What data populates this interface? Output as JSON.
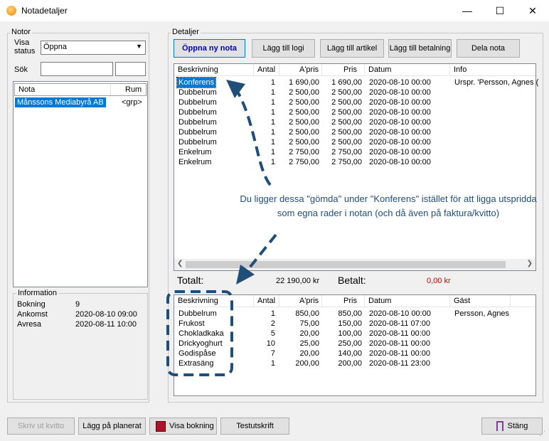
{
  "window": {
    "title": "Notadetaljer",
    "minimize": "—",
    "maximize": "☐",
    "close": "✕"
  },
  "notor": {
    "group_label": "Notor",
    "visa_status_label": "Visa status",
    "status_value": "Öppna",
    "sok_label": "Sök",
    "columns": [
      "Nota",
      "Rum"
    ],
    "rows": [
      {
        "nota": "Månssons Mediabyrå AB",
        "rum": "<grp>"
      }
    ]
  },
  "information": {
    "group_label": "Information",
    "rows": [
      {
        "label": "Bokning",
        "value": "9"
      },
      {
        "label": "Ankomst",
        "value": "2020-08-10 09:00"
      },
      {
        "label": "Avresa",
        "value": "2020-08-11 10:00"
      }
    ]
  },
  "detaljer": {
    "group_label": "Detaljer",
    "buttons": [
      "Öppna ny nota",
      "Lägg till logi",
      "Lägg till artikel",
      "Lägg till betalning",
      "Dela nota"
    ],
    "upper_columns": [
      "Beskrivning",
      "Antal",
      "A'pris",
      "Pris",
      "Datum",
      "Info"
    ],
    "upper_rows": [
      {
        "beskrivning": "Konferens",
        "antal": "1",
        "apris": "1 690,00",
        "pris": "1 690,00",
        "datum": "2020-08-10 00:00",
        "info": "Urspr. 'Persson, Agnes ("
      },
      {
        "beskrivning": "Dubbelrum",
        "antal": "1",
        "apris": "2 500,00",
        "pris": "2 500,00",
        "datum": "2020-08-10 00:00",
        "info": ""
      },
      {
        "beskrivning": "Dubbelrum",
        "antal": "1",
        "apris": "2 500,00",
        "pris": "2 500,00",
        "datum": "2020-08-10 00:00",
        "info": ""
      },
      {
        "beskrivning": "Dubbelrum",
        "antal": "1",
        "apris": "2 500,00",
        "pris": "2 500,00",
        "datum": "2020-08-10 00:00",
        "info": ""
      },
      {
        "beskrivning": "Dubbelrum",
        "antal": "1",
        "apris": "2 500,00",
        "pris": "2 500,00",
        "datum": "2020-08-10 00:00",
        "info": ""
      },
      {
        "beskrivning": "Dubbelrum",
        "antal": "1",
        "apris": "2 500,00",
        "pris": "2 500,00",
        "datum": "2020-08-10 00:00",
        "info": ""
      },
      {
        "beskrivning": "Dubbelrum",
        "antal": "1",
        "apris": "2 500,00",
        "pris": "2 500,00",
        "datum": "2020-08-10 00:00",
        "info": ""
      },
      {
        "beskrivning": "Enkelrum",
        "antal": "1",
        "apris": "2 750,00",
        "pris": "2 750,00",
        "datum": "2020-08-10 00:00",
        "info": ""
      },
      {
        "beskrivning": "Enkelrum",
        "antal": "1",
        "apris": "2 750,00",
        "pris": "2 750,00",
        "datum": "2020-08-10 00:00",
        "info": ""
      }
    ],
    "annotation": "Du ligger dessa \"gömda\" under \"Konferens\" istället för att ligga utspridda som egna rader i notan (och då även på faktura/kvitto)",
    "totalt_label": "Totalt:",
    "totalt_value": "22 190,00 kr",
    "betalt_label": "Betalt:",
    "betalt_value": "0,00 kr",
    "lower_columns": [
      "Beskrivning",
      "Antal",
      "A'pris",
      "Pris",
      "Datum",
      "Gäst"
    ],
    "lower_rows": [
      {
        "beskrivning": "Dubbelrum",
        "antal": "1",
        "apris": "850,00",
        "pris": "850,00",
        "datum": "2020-08-10 00:00",
        "gast": "Persson, Agnes"
      },
      {
        "beskrivning": "Frukost",
        "antal": "2",
        "apris": "75,00",
        "pris": "150,00",
        "datum": "2020-08-11 07:00",
        "gast": ""
      },
      {
        "beskrivning": "Chokladkaka",
        "antal": "5",
        "apris": "20,00",
        "pris": "100,00",
        "datum": "2020-08-11 00:00",
        "gast": ""
      },
      {
        "beskrivning": "Drickyoghurt",
        "antal": "10",
        "apris": "25,00",
        "pris": "250,00",
        "datum": "2020-08-11 00:00",
        "gast": ""
      },
      {
        "beskrivning": "Godispåse",
        "antal": "7",
        "apris": "20,00",
        "pris": "140,00",
        "datum": "2020-08-11 00:00",
        "gast": ""
      },
      {
        "beskrivning": "Extrasäng",
        "antal": "1",
        "apris": "200,00",
        "pris": "200,00",
        "datum": "2020-08-11 23:00",
        "gast": ""
      }
    ]
  },
  "footer": {
    "buttons": [
      "Skriv ut kvitto",
      "Lägg på planerat",
      "Visa bokning",
      "Testutskrift"
    ],
    "close_button": "Stäng"
  },
  "colors": {
    "selection": "#0078d7",
    "annotation": "#1f4e79",
    "betalt": "#d00000",
    "accent_button": "#0000c0"
  }
}
